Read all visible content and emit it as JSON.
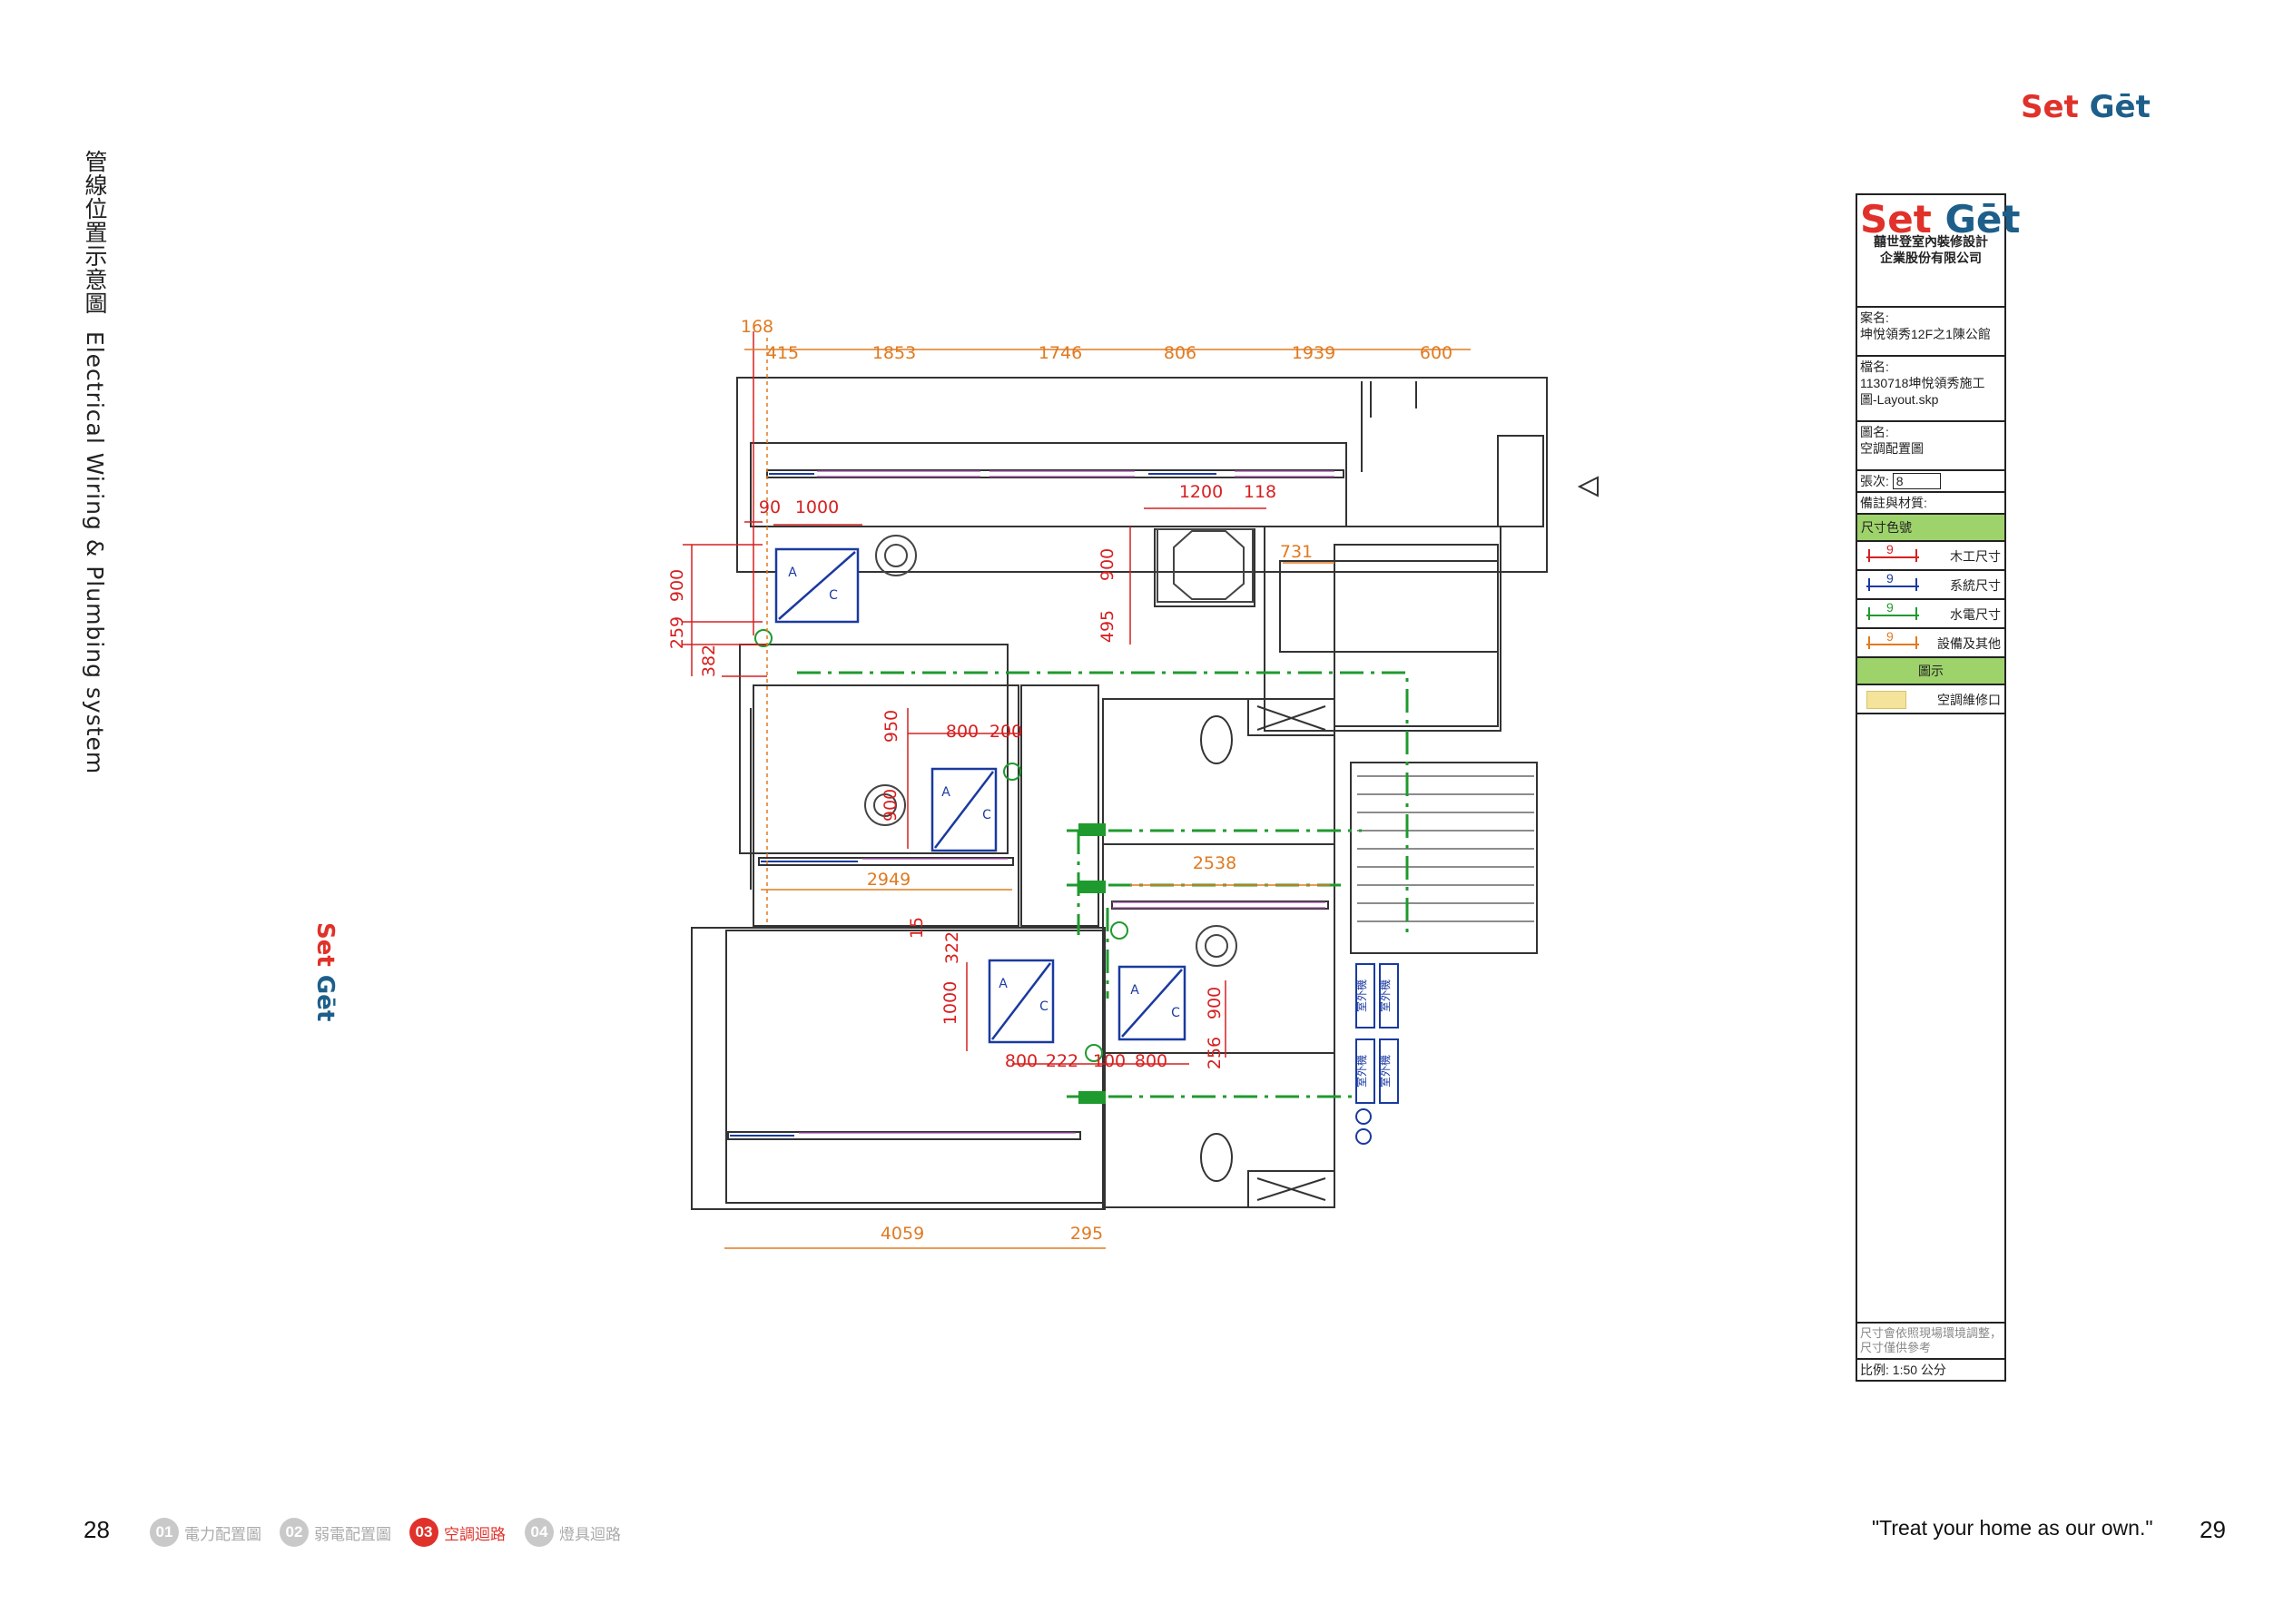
{
  "brand": {
    "name_a": "Set ",
    "name_b": "Gēt"
  },
  "side_title": {
    "zh": "管線位置示意圖",
    "en": "Electrical Wiring & Plumbing system"
  },
  "title_block": {
    "company_line1": "囍世登室內裝修設計",
    "company_line2": "企業股份有限公司",
    "case_label": "案名:",
    "case_value": "坤悅領秀12F之1陳公館",
    "file_label": "檔名:",
    "file_value": "1130718坤悅領秀施工圖-Layout.skp",
    "drawing_label": "圖名:",
    "drawing_value": "空調配置圖",
    "sheet_label": "張次:",
    "sheet_value": "8",
    "remarks_label": "備註與材質:",
    "dim_colors_label": "尺寸色號",
    "legend": [
      {
        "num": "9",
        "label": "木工尺寸",
        "color": "#d62020"
      },
      {
        "num": "9",
        "label": "系統尺寸",
        "color": "#1a3aa0"
      },
      {
        "num": "9",
        "label": "水電尺寸",
        "color": "#1f9a2e"
      },
      {
        "num": "9",
        "label": "設備及其他",
        "color": "#e07a20"
      }
    ],
    "symbol_label": "圖示",
    "symbol_item": "空調維修口",
    "note": "尺寸會依照現場環境調整，尺寸僅供參考",
    "scale": "比例: 1:50 公分"
  },
  "plan": {
    "top_dims": [
      "168",
      "415",
      "1853",
      "1746",
      "806",
      "1939",
      "600"
    ],
    "red_dims": [
      "90",
      "1000",
      "900",
      "259",
      "382",
      "1200",
      "118",
      "900",
      "495",
      "950",
      "800",
      "200",
      "900",
      "15",
      "322",
      "1000",
      "800",
      "222",
      "100",
      "800",
      "900",
      "256"
    ],
    "orange_dims": [
      "731",
      "2949",
      "2538",
      "4059",
      "295"
    ],
    "ac_letters": [
      "A",
      "C"
    ],
    "outdoor_unit_label": "室外機"
  },
  "footer": {
    "page_left": "28",
    "page_right": "29",
    "nav": [
      {
        "num": "01",
        "label": "電力配置圖",
        "active": false
      },
      {
        "num": "02",
        "label": "弱電配置圖",
        "active": false
      },
      {
        "num": "03",
        "label": "空調迴路",
        "active": true
      },
      {
        "num": "04",
        "label": "燈具迴路",
        "active": false
      }
    ],
    "tagline": "\"Treat your home as our own.\""
  },
  "colors": {
    "brand_red": "#e0312a",
    "brand_blue": "#1d5f8a",
    "dim_red": "#d62020",
    "dim_orange": "#e07a20",
    "pipe_green": "#1f9a2e",
    "system_blue": "#1a3aa0"
  }
}
